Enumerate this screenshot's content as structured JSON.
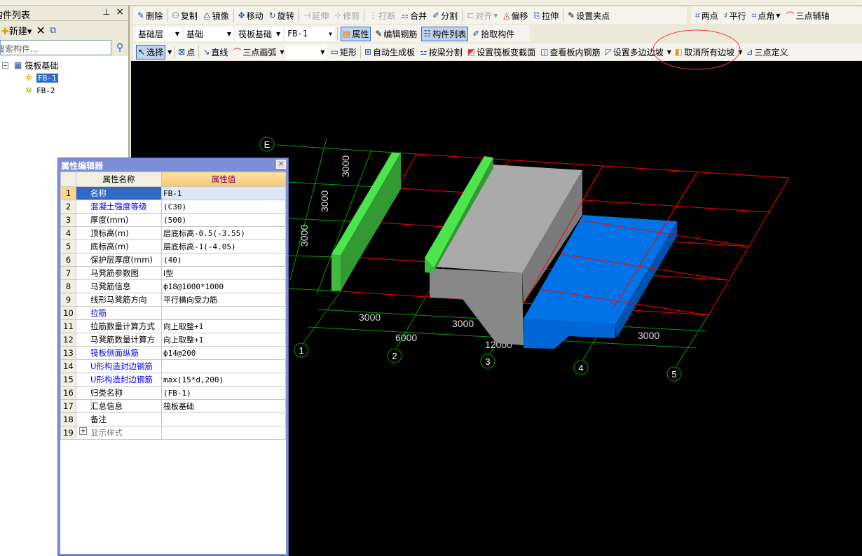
{
  "left_panel": {
    "title": "构件列表",
    "new_label": "新建",
    "search_placeholder": "搜索构件...",
    "tree": {
      "root": "筏板基础",
      "children": [
        "FB-1",
        "FB-2"
      ],
      "selected": "FB-1"
    }
  },
  "toolbar1": [
    "删除",
    "复制",
    "镜像",
    "移动",
    "旋转",
    "延伸",
    "修剪",
    "打断",
    "合并",
    "分割",
    "对齐",
    "偏移",
    "拉伸",
    "设置夹点"
  ],
  "toolbar1b": [
    "两点",
    "平行",
    "点角",
    "三点辅轴"
  ],
  "toolbar2": {
    "floor": "基础层",
    "category": "基础",
    "type": "筏板基础",
    "component": "FB-1",
    "buttons": [
      "属性",
      "编辑钢筋",
      "构件列表",
      "拾取构件"
    ]
  },
  "toolbar3": [
    "选择",
    "点",
    "直线",
    "三点画弧",
    "矩形",
    "自动生成板",
    "按梁分割",
    "设置筏板变截面",
    "查看板内钢筋",
    "设置多边边坡",
    "取消所有边坡",
    "三点定义"
  ],
  "property_editor": {
    "title": "属性编辑器",
    "col_name": "属性名称",
    "col_value": "属性值",
    "rows": [
      {
        "n": "1",
        "name": "名称",
        "value": "FB-1"
      },
      {
        "n": "2",
        "name": "混凝土强度等级",
        "value": "(C30)",
        "blue": true
      },
      {
        "n": "3",
        "name": "厚度(mm)",
        "value": "(500)"
      },
      {
        "n": "4",
        "name": "顶标高(m)",
        "value": "层底标高-0.5(-3.55)"
      },
      {
        "n": "5",
        "name": "底标高(m)",
        "value": "层底标高-1(-4.05)"
      },
      {
        "n": "6",
        "name": "保护层厚度(mm)",
        "value": "(40)"
      },
      {
        "n": "7",
        "name": "马凳筋参数图",
        "value": "Ⅰ型"
      },
      {
        "n": "8",
        "name": "马凳筋信息",
        "value": "ф18@1000*1000"
      },
      {
        "n": "9",
        "name": "线形马凳筋方向",
        "value": "平行横向受力筋"
      },
      {
        "n": "10",
        "name": "拉筋",
        "value": "",
        "blue": true
      },
      {
        "n": "11",
        "name": "拉筋数量计算方式",
        "value": "向上取整+1"
      },
      {
        "n": "12",
        "name": "马凳筋数量计算方",
        "value": "向上取整+1"
      },
      {
        "n": "13",
        "name": "筏板侧面纵筋",
        "value": "ф14@200",
        "blue": true
      },
      {
        "n": "14",
        "name": "U形构造封边钢筋",
        "value": "",
        "blue": true
      },
      {
        "n": "15",
        "name": "U形构造封边钢筋",
        "value": "max(15*d,200)",
        "blue": true
      },
      {
        "n": "16",
        "name": "归类名称",
        "value": "(FB-1)"
      },
      {
        "n": "17",
        "name": "汇总信息",
        "value": "筏板基础"
      },
      {
        "n": "18",
        "name": "备注",
        "value": ""
      },
      {
        "n": "19",
        "name": "显示样式",
        "value": "",
        "gray": true,
        "expand": "+"
      }
    ]
  },
  "scene": {
    "axes": [
      "E",
      "1",
      "2",
      "3",
      "4",
      "5"
    ],
    "dims_vertical": [
      "3000",
      "3000",
      "3000"
    ],
    "dims_bottom": [
      "3000",
      "3000",
      "3000",
      "6000",
      "12000"
    ],
    "colors": {
      "grid_red": "#ff0000",
      "grid_green": "#00a000",
      "slab_blue": "#0073e6",
      "box_gray": "#aaaaaa",
      "wall_green": "#4ce64c"
    }
  }
}
